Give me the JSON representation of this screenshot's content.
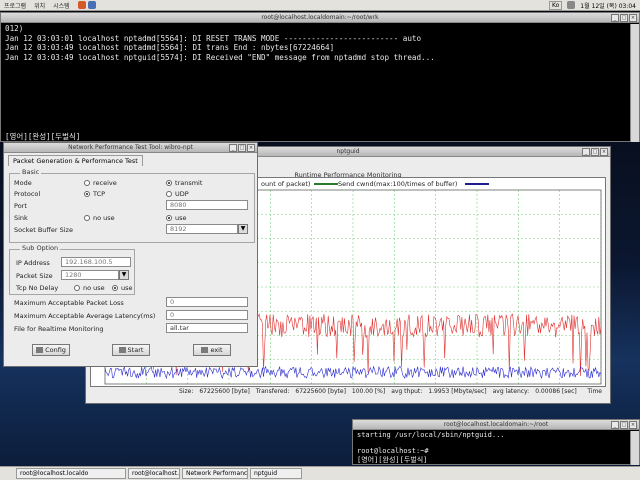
{
  "top_panel": {
    "menus": [
      "프로그램",
      "위치",
      "시스템"
    ],
    "input_method": "Ko",
    "clock": "1월 12일 (목) 03:04"
  },
  "term_main": {
    "title": "root@localhost.localdomain:~/root/wrk",
    "lines": [
      "012)",
      "Jan 12 03:03:01 localhost nptadmd[5564]: DI RESET TRANS MODE ------------------------- auto",
      "Jan 12 03:03:49 localhost nptadmd[5564]: DI trans End : nbytes[67224664]",
      "Jan 12 03:03:49 localhost nptguid[5574]: DI Received \"END\" message from nptadmd stop thread..."
    ],
    "status": "[영어][완성][두벌식]"
  },
  "term_small": {
    "title": "root@localhost.localdomain:~/root",
    "lines": [
      "starting /usr/local/sbin/nptguid...",
      "",
      "root@localhost:~#"
    ],
    "status": "[영어][완성][두벌식]"
  },
  "tool_window": {
    "title": "Network Performance Test Tool: wibro-npt",
    "tab_label": "Packet Generation & Performance Test",
    "basic": {
      "section_label": "Basic",
      "mode_label": "Mode",
      "mode_options": [
        "receive",
        "transmit"
      ],
      "protocol_label": "Protocol",
      "protocol_options": [
        "TCP",
        "UDP"
      ],
      "port_label": "Port",
      "port_value": "8080",
      "sink_label": "Sink",
      "sink_options": [
        "no use",
        "use"
      ],
      "buffer_label": "Socket Buffer Size",
      "buffer_value": "8192"
    },
    "sub": {
      "section_label": "Sub Option",
      "ip_label": "IP Address",
      "ip_value": "192.168.100.5",
      "packet_label": "Packet Size",
      "packet_value": "1280",
      "nodelay_label": "Tcp No Delay",
      "nodelay_options": [
        "no use",
        "use"
      ]
    },
    "max_loss_label": "Maximum Acceptable Packet Loss",
    "max_loss_value": "0",
    "max_latency_label": "Maximum Acceptable Average Latency(ms)",
    "max_latency_value": "0",
    "monitor_file_label": "File for Realtime Monitoring",
    "monitor_file_value": "all.tar",
    "buttons": {
      "config": "Config",
      "start": "Start",
      "exit": "exit"
    }
  },
  "graph_window": {
    "title": "nptguid",
    "chart_title": "Runtime Performance Monitoring",
    "legend_left": "ount of packet)",
    "legend_right": "Send cwnd(max:100/times of buffer)",
    "footer": {
      "size_label": "Size:",
      "size_value": "67225600 [byte]",
      "transferred_label": "Transfered:",
      "transferred_value": "67225600 [byte]",
      "percent": "100.00 [%]",
      "thput_label": "avg thput:",
      "thput_value": "1.9953 [Mbyte/sec]",
      "latency_label": "avg latency:",
      "latency_value": "0.00086 [sec]",
      "time_label": "Time"
    },
    "colors": {
      "red_series": "#e03030",
      "blue_series": "#2a2ad0",
      "grid": "#7fd07f"
    }
  },
  "taskbar": {
    "tasks": [
      "root@localhost.localdo",
      "root@localhost.localdo",
      "Network Performance",
      "nptguid"
    ]
  }
}
